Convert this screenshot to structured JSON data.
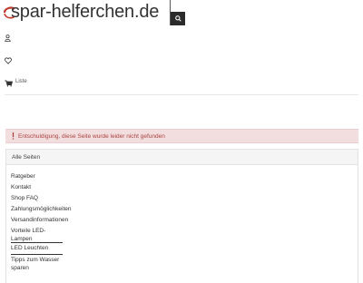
{
  "header": {
    "logo_text": "spar-helferchen.de",
    "search_label": ""
  },
  "nav": {
    "cart_label": "Liste"
  },
  "alert": {
    "message": "Entschuldigung, diese Seite wurde leider nicht gefunden"
  },
  "panel": {
    "title": "Alle Seiten",
    "links": [
      "Ratgeber",
      "Kontakt",
      "Shop FAQ",
      "Zahlungsmöglichkeiten",
      "Versandinformationen",
      "Vorteile LED-",
      "Lampen",
      "LED Leuchten",
      "Tipps zum Wasser",
      "sparen"
    ]
  },
  "colors": {
    "alert_bg": "#f2dede",
    "alert_text": "#a94442",
    "logo_accent": "#c0392b",
    "search_bg": "#2b2b2b"
  }
}
